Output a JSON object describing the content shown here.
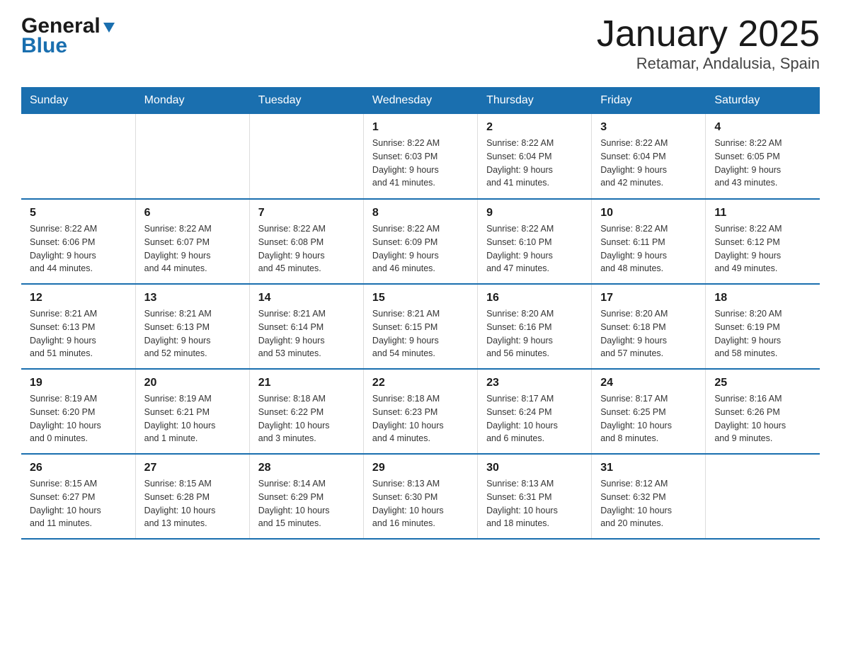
{
  "header": {
    "logo_line1": "General",
    "logo_line2": "Blue",
    "title": "January 2025",
    "subtitle": "Retamar, Andalusia, Spain"
  },
  "days_of_week": [
    "Sunday",
    "Monday",
    "Tuesday",
    "Wednesday",
    "Thursday",
    "Friday",
    "Saturday"
  ],
  "weeks": [
    [
      {
        "day": "",
        "info": ""
      },
      {
        "day": "",
        "info": ""
      },
      {
        "day": "",
        "info": ""
      },
      {
        "day": "1",
        "info": "Sunrise: 8:22 AM\nSunset: 6:03 PM\nDaylight: 9 hours\nand 41 minutes."
      },
      {
        "day": "2",
        "info": "Sunrise: 8:22 AM\nSunset: 6:04 PM\nDaylight: 9 hours\nand 41 minutes."
      },
      {
        "day": "3",
        "info": "Sunrise: 8:22 AM\nSunset: 6:04 PM\nDaylight: 9 hours\nand 42 minutes."
      },
      {
        "day": "4",
        "info": "Sunrise: 8:22 AM\nSunset: 6:05 PM\nDaylight: 9 hours\nand 43 minutes."
      }
    ],
    [
      {
        "day": "5",
        "info": "Sunrise: 8:22 AM\nSunset: 6:06 PM\nDaylight: 9 hours\nand 44 minutes."
      },
      {
        "day": "6",
        "info": "Sunrise: 8:22 AM\nSunset: 6:07 PM\nDaylight: 9 hours\nand 44 minutes."
      },
      {
        "day": "7",
        "info": "Sunrise: 8:22 AM\nSunset: 6:08 PM\nDaylight: 9 hours\nand 45 minutes."
      },
      {
        "day": "8",
        "info": "Sunrise: 8:22 AM\nSunset: 6:09 PM\nDaylight: 9 hours\nand 46 minutes."
      },
      {
        "day": "9",
        "info": "Sunrise: 8:22 AM\nSunset: 6:10 PM\nDaylight: 9 hours\nand 47 minutes."
      },
      {
        "day": "10",
        "info": "Sunrise: 8:22 AM\nSunset: 6:11 PM\nDaylight: 9 hours\nand 48 minutes."
      },
      {
        "day": "11",
        "info": "Sunrise: 8:22 AM\nSunset: 6:12 PM\nDaylight: 9 hours\nand 49 minutes."
      }
    ],
    [
      {
        "day": "12",
        "info": "Sunrise: 8:21 AM\nSunset: 6:13 PM\nDaylight: 9 hours\nand 51 minutes."
      },
      {
        "day": "13",
        "info": "Sunrise: 8:21 AM\nSunset: 6:13 PM\nDaylight: 9 hours\nand 52 minutes."
      },
      {
        "day": "14",
        "info": "Sunrise: 8:21 AM\nSunset: 6:14 PM\nDaylight: 9 hours\nand 53 minutes."
      },
      {
        "day": "15",
        "info": "Sunrise: 8:21 AM\nSunset: 6:15 PM\nDaylight: 9 hours\nand 54 minutes."
      },
      {
        "day": "16",
        "info": "Sunrise: 8:20 AM\nSunset: 6:16 PM\nDaylight: 9 hours\nand 56 minutes."
      },
      {
        "day": "17",
        "info": "Sunrise: 8:20 AM\nSunset: 6:18 PM\nDaylight: 9 hours\nand 57 minutes."
      },
      {
        "day": "18",
        "info": "Sunrise: 8:20 AM\nSunset: 6:19 PM\nDaylight: 9 hours\nand 58 minutes."
      }
    ],
    [
      {
        "day": "19",
        "info": "Sunrise: 8:19 AM\nSunset: 6:20 PM\nDaylight: 10 hours\nand 0 minutes."
      },
      {
        "day": "20",
        "info": "Sunrise: 8:19 AM\nSunset: 6:21 PM\nDaylight: 10 hours\nand 1 minute."
      },
      {
        "day": "21",
        "info": "Sunrise: 8:18 AM\nSunset: 6:22 PM\nDaylight: 10 hours\nand 3 minutes."
      },
      {
        "day": "22",
        "info": "Sunrise: 8:18 AM\nSunset: 6:23 PM\nDaylight: 10 hours\nand 4 minutes."
      },
      {
        "day": "23",
        "info": "Sunrise: 8:17 AM\nSunset: 6:24 PM\nDaylight: 10 hours\nand 6 minutes."
      },
      {
        "day": "24",
        "info": "Sunrise: 8:17 AM\nSunset: 6:25 PM\nDaylight: 10 hours\nand 8 minutes."
      },
      {
        "day": "25",
        "info": "Sunrise: 8:16 AM\nSunset: 6:26 PM\nDaylight: 10 hours\nand 9 minutes."
      }
    ],
    [
      {
        "day": "26",
        "info": "Sunrise: 8:15 AM\nSunset: 6:27 PM\nDaylight: 10 hours\nand 11 minutes."
      },
      {
        "day": "27",
        "info": "Sunrise: 8:15 AM\nSunset: 6:28 PM\nDaylight: 10 hours\nand 13 minutes."
      },
      {
        "day": "28",
        "info": "Sunrise: 8:14 AM\nSunset: 6:29 PM\nDaylight: 10 hours\nand 15 minutes."
      },
      {
        "day": "29",
        "info": "Sunrise: 8:13 AM\nSunset: 6:30 PM\nDaylight: 10 hours\nand 16 minutes."
      },
      {
        "day": "30",
        "info": "Sunrise: 8:13 AM\nSunset: 6:31 PM\nDaylight: 10 hours\nand 18 minutes."
      },
      {
        "day": "31",
        "info": "Sunrise: 8:12 AM\nSunset: 6:32 PM\nDaylight: 10 hours\nand 20 minutes."
      },
      {
        "day": "",
        "info": ""
      }
    ]
  ]
}
